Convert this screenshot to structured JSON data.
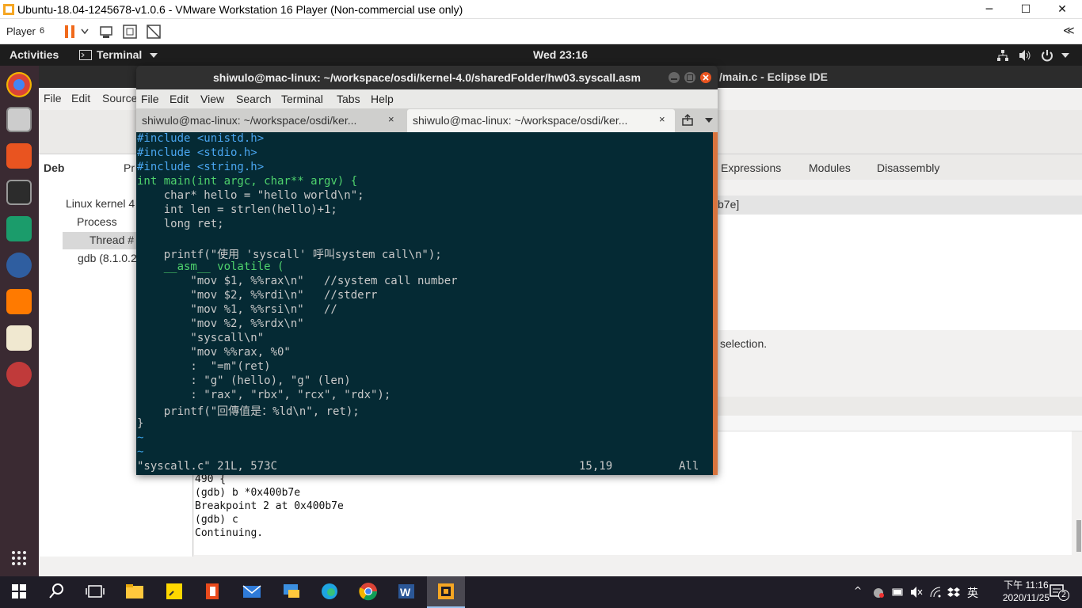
{
  "vmware": {
    "title": "Ubuntu-18.04-1245678-v1.0.6 - VMware Workstation 16 Player (Non-commercial use only)",
    "player_label": "Player",
    "player_num": "6",
    "minimize": "─",
    "maximize": "☐",
    "close": "✕",
    "collapse": "≪"
  },
  "ubuntu": {
    "activities": "Activities",
    "app_name": "Terminal",
    "clock": "Wed 23:16"
  },
  "eclipse": {
    "title": "/main.c - Eclipse IDE",
    "menu": [
      "File",
      "Edit",
      "Source"
    ],
    "debug_tab": "Deb",
    "projects_tab": "Pr",
    "tree": {
      "kernel": "Linux kernel 4",
      "process": "Process",
      "thread": "Thread #",
      "gdb": "gdb (8.1.0.2"
    },
    "view_tabs": {
      "expressions": "Expressions",
      "modules": "Modules",
      "disassembly": "Disassembly"
    },
    "address_snip": "b7e]",
    "selection_text": "selection.",
    "console_lines": [
      "490     {",
      "(gdb) b *0x400b7e",
      "Breakpoint 2 at 0x400b7e",
      "(gdb) c",
      "Continuing."
    ]
  },
  "terminal": {
    "title": "shiwulo@mac-linux: ~/workspace/osdi/kernel-4.0/sharedFolder/hw03.syscall.asm",
    "menu": [
      "File",
      "Edit",
      "View",
      "Search",
      "Terminal",
      "Tabs",
      "Help"
    ],
    "tabs": [
      {
        "label": "shiwulo@mac-linux: ~/workspace/osdi/ker...",
        "close": "×"
      },
      {
        "label": "shiwulo@mac-linux: ~/workspace/osdi/ker...",
        "close": "×"
      }
    ],
    "code_lines": [
      "#include <unistd.h>",
      "#include <stdio.h>",
      "#include <string.h>",
      "int main(int argc, char** argv) {",
      "    char* hello = \"hello world\\n\";",
      "    int len = strlen(hello)+1;",
      "    long ret;",
      "",
      "    printf(\"使用 'syscall' 呼叫system call\\n\");",
      "    __asm__ volatile (",
      "        \"mov $1, %%rax\\n\"   //system call number",
      "        \"mov $2, %%rdi\\n\"   //stderr",
      "        \"mov %1, %%rsi\\n\"   //",
      "        \"mov %2, %%rdx\\n\"",
      "        \"syscall\\n\"",
      "        \"mov %%rax, %0\"",
      "        :  \"=m\"(ret)",
      "        : \"g\" (hello), \"g\" (len)",
      "        : \"rax\", \"rbx\", \"rcx\", \"rdx\");",
      "    printf(\"回傳值是：%ld\\n\", ret);",
      "}",
      "~",
      "~"
    ],
    "status_left": "\"syscall.c\" 21L, 573C",
    "status_pos": "15,19",
    "status_right": "All"
  },
  "taskbar": {
    "time": "下午 11:16",
    "date": "2020/11/25",
    "ime": "英",
    "notif_count": "2"
  }
}
